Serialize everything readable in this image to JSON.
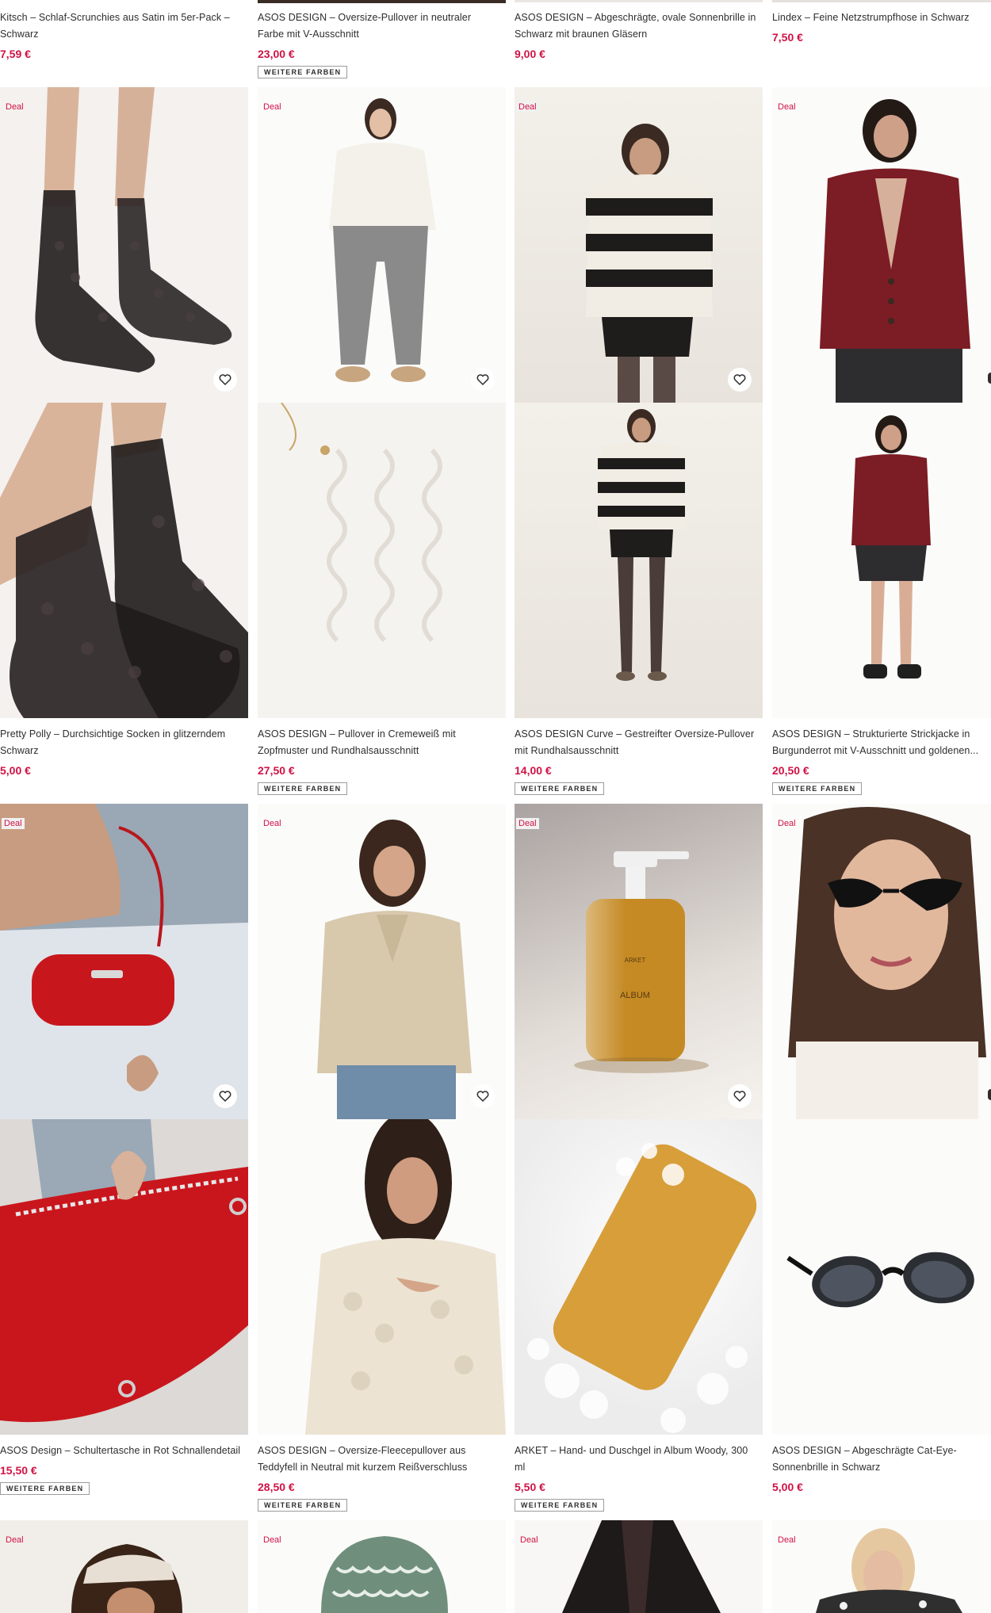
{
  "deal_label": "Deal",
  "more_colors_label": "WEITERE FARBEN",
  "top_row": [
    {
      "title": "Kitsch – Schlaf-Scrunchies aus Satin im 5er-Pack – Schwarz",
      "price": "7,59 €"
    },
    {
      "title": "ASOS DESIGN – Oversize-Pullover in neutraler Farbe mit V-Ausschnitt",
      "price": "23,00 €",
      "more_colors": true
    },
    {
      "title": "ASOS DESIGN – Abgeschrägte, ovale Sonnenbrille in Schwarz mit braunen Gläsern",
      "price": "9,00 €"
    },
    {
      "title": "Lindex – Feine Netzstrumpfhose in Schwarz",
      "price": "7,50 €"
    }
  ],
  "rows": [
    {
      "products": [
        {
          "title": "Pretty Polly – Durchsichtige Socken in glitzerndem Schwarz",
          "price": "5,00 €",
          "image": "sheer-glitter-socks",
          "more_colors": false
        },
        {
          "title": "ASOS DESIGN – Pullover in Cremeweiß mit Zopfmuster und Rundhalsausschnitt",
          "price": "27,50 €",
          "image": "cream-cable-sweater",
          "more_colors": true
        },
        {
          "title": "ASOS DESIGN Curve – Gestreifter Oversize-Pullover mit Rundhalsausschnitt",
          "price": "14,00 €",
          "image": "striped-sweater",
          "more_colors": true
        },
        {
          "title": "ASOS DESIGN – Strukturierte Strickjacke in Burgunderrot mit V-Ausschnitt und goldenen...",
          "price": "20,50 €",
          "image": "burgundy-cardigan",
          "more_colors": true
        }
      ]
    },
    {
      "products": [
        {
          "title": "ASOS Design – Schultertasche in Rot Schnallendetail",
          "price": "15,50 €",
          "image": "red-shoulder-bag",
          "more_colors": true
        },
        {
          "title": "ASOS DESIGN – Oversize-Fleecepullover aus Teddyfell in Neutral mit kurzem Reißverschluss",
          "price": "28,50 €",
          "image": "teddy-fleece",
          "more_colors": true
        },
        {
          "title": "ARKET – Hand- und Duschgel in Album Woody, 300 ml",
          "price": "5,50 €",
          "image": "album-hand-wash",
          "more_colors": true
        },
        {
          "title": "ASOS DESIGN – Abgeschrägte Cat-Eye-Sonnenbrille in Schwarz",
          "price": "5,00 €",
          "image": "cat-eye-sunglasses",
          "more_colors": false
        }
      ]
    }
  ],
  "soap_label": "ALBUM",
  "soap_brand": "ARKET"
}
